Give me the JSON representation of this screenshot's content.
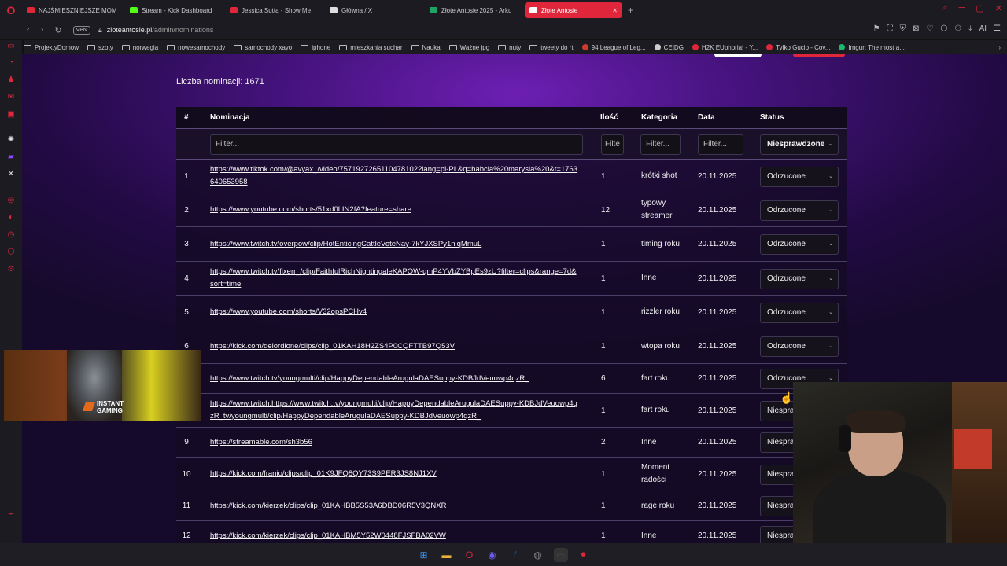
{
  "tabs": [
    {
      "label": "NAJŚMIESZNIEJSZE MOM",
      "color": "#e0263b",
      "active": false
    },
    {
      "label": "Stream - Kick Dashboard",
      "color": "#53fc18",
      "active": false
    },
    {
      "label": "Jessica Sutta - Show Me",
      "color": "#e0263b",
      "active": false
    },
    {
      "label": "Główna / X",
      "color": "#dddddd",
      "active": false
    },
    {
      "label": "Złote Antosie 2025 - Arku",
      "color": "#1fa463",
      "active": false
    },
    {
      "label": "Złote Antosie",
      "color": "#ffffff",
      "active": true
    }
  ],
  "address": {
    "vpn": "VPN",
    "domain": "zloteantosie.pl",
    "path": "/admin/nominations",
    "ai": "AI"
  },
  "bookmarks": [
    {
      "label": "ProjektyDomow",
      "type": "folder"
    },
    {
      "label": "szoty",
      "type": "folder"
    },
    {
      "label": "norwegia",
      "type": "folder"
    },
    {
      "label": "nowesamochody",
      "type": "folder"
    },
    {
      "label": "samochody xayo",
      "type": "folder"
    },
    {
      "label": "iphone",
      "type": "folder"
    },
    {
      "label": "mieszkania suchar",
      "type": "folder"
    },
    {
      "label": "Nauka",
      "type": "folder"
    },
    {
      "label": "Ważne jpg",
      "type": "folder"
    },
    {
      "label": "nuty",
      "type": "folder"
    },
    {
      "label": "tweety do rt",
      "type": "folder"
    },
    {
      "label": "94 League of Leg...",
      "type": "site",
      "color": "#d03a2a"
    },
    {
      "label": "CEIDG",
      "type": "site",
      "color": "#cccccc"
    },
    {
      "label": "H2K EUphoria! - Y...",
      "type": "site",
      "color": "#e0263b"
    },
    {
      "label": "Tylko Gucio - Cov...",
      "type": "site",
      "color": "#e0263b"
    },
    {
      "label": "Imgur: The most a...",
      "type": "site",
      "color": "#1bb76e"
    }
  ],
  "page": {
    "count_label": "Liczba nominacji: 1671",
    "headers": {
      "num": "#",
      "nominacja": "Nominacja",
      "ilosc": "Ilość",
      "kategoria": "Kategoria",
      "data": "Data",
      "status": "Status"
    },
    "filters": {
      "nominacja": "Filter...",
      "ilosc": "Filte",
      "kategoria": "Filter...",
      "data": "Filter...",
      "status": "Niesprawdzone"
    }
  },
  "rows": [
    {
      "num": "1",
      "link": "https://www.tiktok.com/@avyax_/video/7571927265110478102?lang=pl-PL&q=babcia%20marysia%20&t=1763640653958",
      "qty": "1",
      "cat": "krótki shot",
      "date": "20.11.2025",
      "status": "Odrzucone",
      "h": 43
    },
    {
      "num": "2",
      "link": "https://www.youtube.com/shorts/51xd0LIN2fA?feature=share",
      "qty": "12",
      "cat": "typowy streamer",
      "date": "20.11.2025",
      "status": "Odrzucone",
      "h": 43
    },
    {
      "num": "3",
      "link": "https://www.twitch.tv/overpow/clip/HotEnticingCattleVoteNay-7kYJXSPy1niqMmuL",
      "qty": "1",
      "cat": "timing roku",
      "date": "20.11.2025",
      "status": "Odrzucone",
      "h": 44
    },
    {
      "num": "4",
      "link": "https://www.twitch.tv/fixerr_/clip/FaithfulRichNightingaleKAPOW-qmP4YVbZYBpEs9zU?filter=clips&range=7d&sort=time",
      "qty": "1",
      "cat": "Inne",
      "date": "20.11.2025",
      "status": "Odrzucone",
      "h": 43
    },
    {
      "num": "5",
      "link": "https://www.youtube.com/shorts/V32opsPCHv4",
      "qty": "1",
      "cat": "rizzler roku",
      "date": "20.11.2025",
      "status": "Odrzucone",
      "h": 43
    },
    {
      "num": "6",
      "link": "https://kick.com/delordione/clips/clip_01KAH18H2ZS4P0CQFTTB97Q53V",
      "qty": "1",
      "cat": "wtopa roku",
      "date": "20.11.2025",
      "status": "Odrzucone",
      "h": 44
    },
    {
      "num": "7",
      "link": "https://www.twitch.tv/youngmulti/clip/HappyDependableArugulaDAESuppy-KDBJdVeuowp4qzR_",
      "qty": "6",
      "cat": "fart roku",
      "date": "20.11.2025",
      "status": "Odrzucone",
      "h": 38
    },
    {
      "num": "8",
      "link": "https://www.twitch.https://www.twitch.tv/youngmulti/clip/HappyDependableArugulaDAESuppy-KDBJdVeuowp4qzR_tv/youngmulti/clip/HappyDependableArugulaDAESuppy-KDBJdVeuowp4qzR_",
      "qty": "1",
      "cat": "fart roku",
      "date": "20.11.2025",
      "status": "Niesprawdzone",
      "h": 43
    },
    {
      "num": "9",
      "link": "https://streamable.com/sh3b56",
      "qty": "2",
      "cat": "Inne",
      "date": "20.11.2025",
      "status": "Niesprawdzone",
      "h": 38
    },
    {
      "num": "10",
      "link": "https://kick.com/franio/clips/clip_01K9JFQ8QY73S9PER3JS8NJ1XV",
      "qty": "1",
      "cat": "Moment radości",
      "date": "20.11.2025",
      "status": "Niesprawdzone",
      "h": 43
    },
    {
      "num": "11",
      "link": "https://kick.com/kierzek/clips/clip_01KAHBB5S53A6DBD06R5V3QNXR",
      "qty": "1",
      "cat": "rage roku",
      "date": "20.11.2025",
      "status": "Niesprawdzone",
      "h": 38
    },
    {
      "num": "12",
      "link": "https://kick.com/kierzek/clips/clip_01KAHBM5Y52W0448FJSFBA02VW",
      "qty": "1",
      "cat": "Inne",
      "date": "20.11.2025",
      "status": "Niesprawdzone",
      "h": 38
    }
  ],
  "overlay": {
    "game_label_1": "INSTANT",
    "game_label_2": "GAMING"
  },
  "taskbar": [
    "windows-icon",
    "explorer-icon",
    "opera-icon",
    "discord-icon",
    "facebook-icon",
    "app-icon",
    "terminal-icon",
    "obs-icon"
  ]
}
